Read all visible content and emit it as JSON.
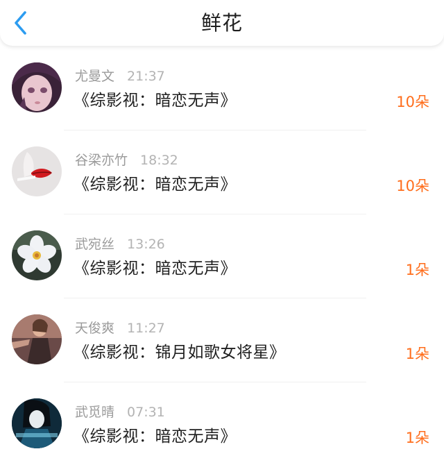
{
  "header": {
    "title": "鲜花",
    "back_icon": "chevron-left-icon",
    "accent_color": "#2c9cf0"
  },
  "items": [
    {
      "name": "尤曼文",
      "time": "21:37",
      "book": "《综影视：暗恋无声》",
      "count": "10朵"
    },
    {
      "name": "谷梁亦竹",
      "time": "18:32",
      "book": "《综影视：暗恋无声》",
      "count": "10朵"
    },
    {
      "name": "武宛丝",
      "time": "13:26",
      "book": "《综影视：暗恋无声》",
      "count": "1朵"
    },
    {
      "name": "天俊爽",
      "time": "11:27",
      "book": "《综影视：锦月如歌女将星》",
      "count": "1朵"
    },
    {
      "name": "武觅晴",
      "time": "07:31",
      "book": "《综影视：暗恋无声》",
      "count": "1朵"
    }
  ],
  "colors": {
    "count_text": "#ff6d1b",
    "meta_text": "#9a9a9a",
    "body_text": "#1f1f1f"
  }
}
